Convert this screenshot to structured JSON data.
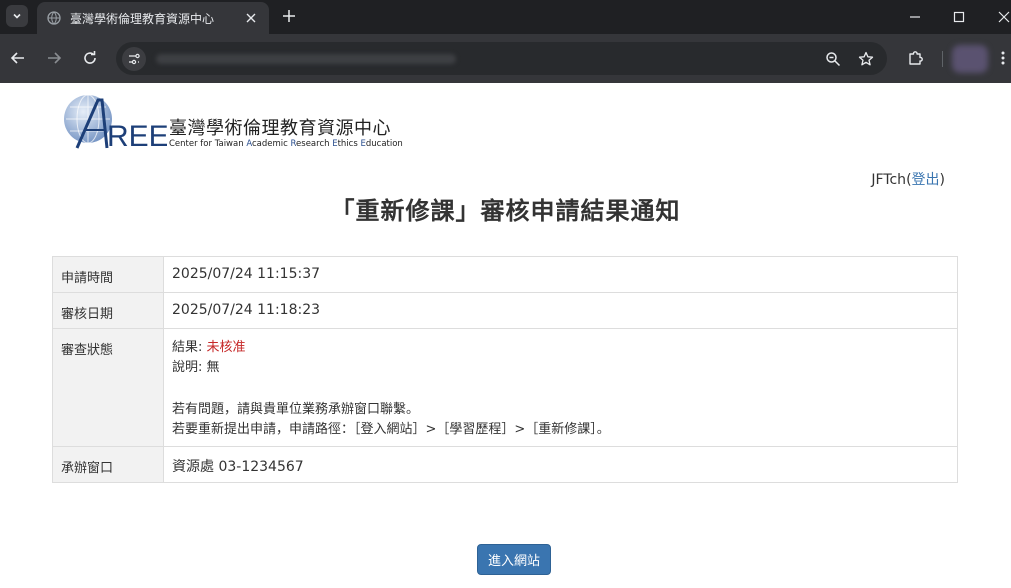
{
  "browser": {
    "tab_title": "臺灣學術倫理教育資源中心",
    "url": ""
  },
  "site": {
    "logo_mark": "AREE",
    "logo_cn": "臺灣學術倫理教育資源中心",
    "logo_en_parts": [
      "Center for Taiwan ",
      "A",
      "cademic ",
      "R",
      "esearch ",
      "E",
      "thics ",
      "E",
      "ducation"
    ]
  },
  "user": {
    "name": "JFTch",
    "open_paren": "(",
    "logout_label": "登出",
    "close_paren": ")"
  },
  "page_title": "「重新修課」審核申請結果通知",
  "table": {
    "rows": [
      {
        "label": "申請時間",
        "value": "2025/07/24 11:15:37"
      },
      {
        "label": "審核日期",
        "value": "2025/07/24 11:18:23"
      },
      {
        "label": "審查狀態"
      },
      {
        "label": "承辦窗口",
        "value": "資源處 03-1234567"
      }
    ],
    "status": {
      "result_label": "結果: ",
      "result_value": "未核准",
      "note": "說明: 無",
      "help_line1": "若有問題，請與貴單位業務承辦窗口聯繫。",
      "help_line2": "若要重新提出申請，申請路徑：［登入網站］>［學習歷程］>［重新修課］。"
    }
  },
  "enter_button_label": "進入網站",
  "colors": {
    "accent": "#3a75b0",
    "status_red": "#c62828",
    "label_bg": "#f2f2f2"
  }
}
